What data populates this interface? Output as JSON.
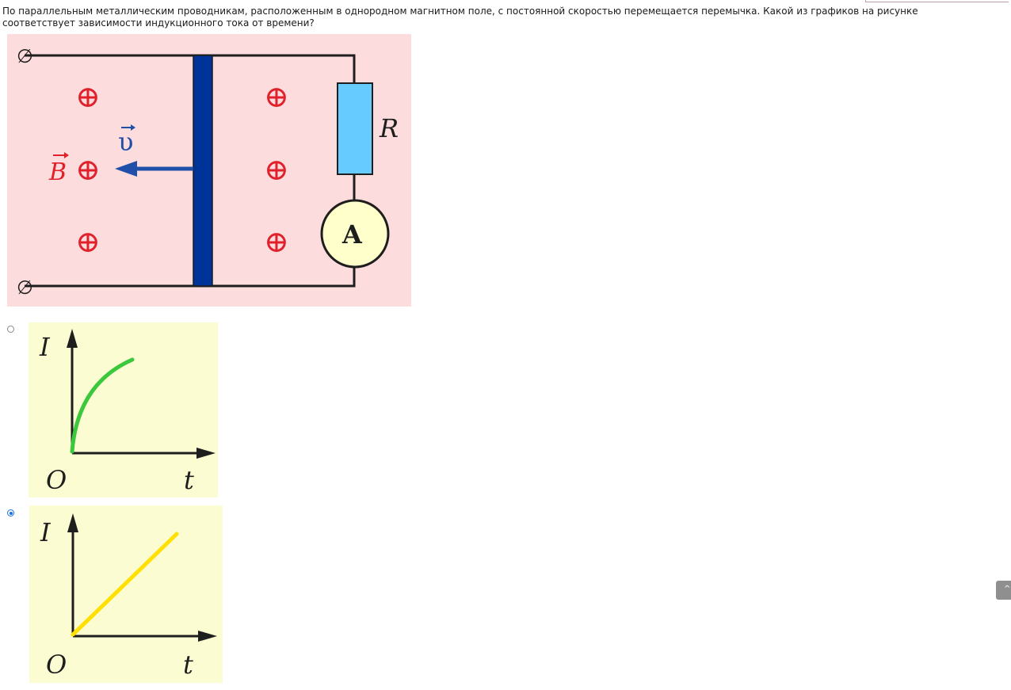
{
  "question": {
    "text": "По параллельным металлическим проводникам, расположенным в однородном магнитном поле, с постоянной скоростью перемещается перемычка. Какой из графиков на рисунке соответствует зависимости индукционного тока от времени?"
  },
  "circuit": {
    "terminal_symbol": "∅",
    "resistor_label": "R",
    "ammeter_label": "A",
    "velocity_label": "υ",
    "field_label": "B",
    "field_symbol": "⊕",
    "colors": {
      "background": "#fcdcdc",
      "rail": "#1e1e1e",
      "bar": "#003399",
      "arrow": "#1f4fa8",
      "field": "#e0202a",
      "resistor": "#66ccff",
      "ammeter": "#ffffcc"
    }
  },
  "options": [
    {
      "checked": false,
      "y_label": "I",
      "x_label": "t",
      "origin_label": "O",
      "curve": "saturating",
      "curve_color": "#3cc83c"
    },
    {
      "checked": true,
      "y_label": "I",
      "x_label": "t",
      "origin_label": "O",
      "curve": "linear",
      "curve_color": "#ffe000"
    }
  ]
}
